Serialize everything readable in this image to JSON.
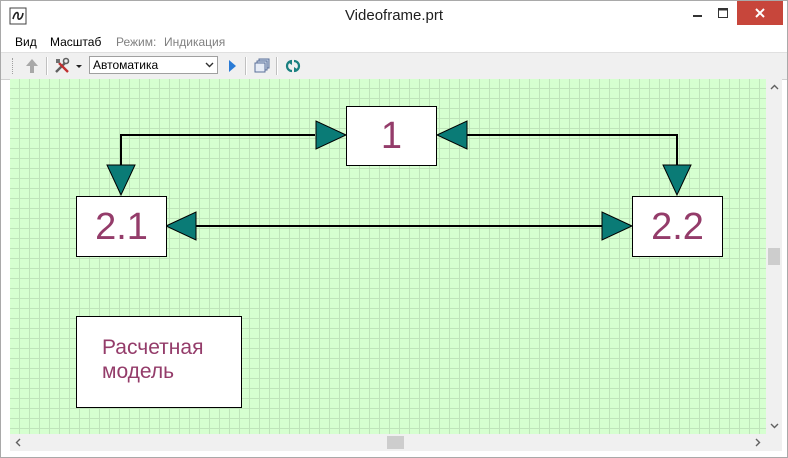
{
  "window": {
    "title": "Videoframe.prt"
  },
  "menu": {
    "items": [
      "Вид",
      "Масштаб"
    ],
    "mode_label": "Режим:",
    "mode_value": "Индикация"
  },
  "toolbar": {
    "select_value": "Автоматика"
  },
  "diagram": {
    "nodes": [
      {
        "id": "1",
        "label": "1"
      },
      {
        "id": "2.1",
        "label": "2.1"
      },
      {
        "id": "2.2",
        "label": "2.2"
      },
      {
        "id": "model",
        "label_line1": "Расчетная",
        "label_line2": "модель"
      }
    ],
    "colors": {
      "background": "#d6ffd0",
      "grid": "#bfe4ba",
      "arrowhead": "#0a7b76",
      "line": "#000000",
      "label": "#943c6a"
    }
  }
}
